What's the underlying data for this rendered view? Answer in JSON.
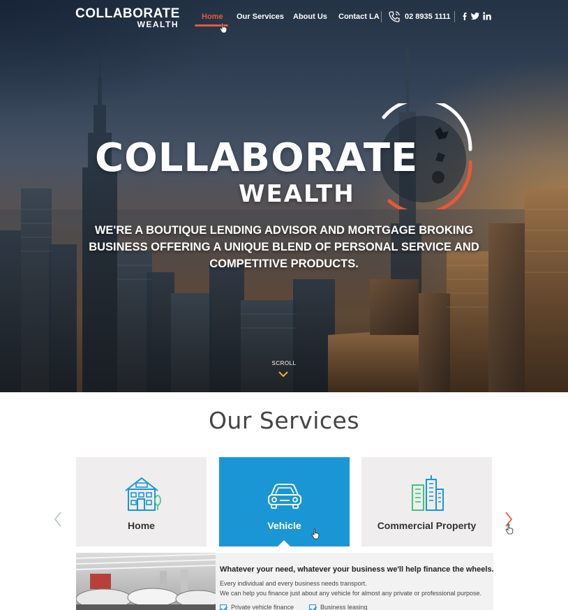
{
  "brand": {
    "logo_line1": "COLLABORATE",
    "logo_line2": "WEALTH",
    "accent_color": "#e8583a",
    "blue_color": "#1b96d4"
  },
  "nav": {
    "items": [
      {
        "label": "Home",
        "active": true
      },
      {
        "label": "Our Services",
        "active": false
      },
      {
        "label": "About Us",
        "active": false
      },
      {
        "label": "Contact LA",
        "active": false
      }
    ],
    "phone": "02 8935 1111",
    "phone_icon": "phone-icon",
    "social": [
      "facebook-icon",
      "twitter-icon",
      "linkedin-icon"
    ]
  },
  "hero": {
    "title_line1": "COLLABORATE",
    "title_line2": "WEALTH",
    "tagline": "WE'RE A BOUTIQUE LENDING ADVISOR AND MORTGAGE BROKING BUSINESS OFFERING A UNIQUE BLEND OF PERSONAL SERVICE AND COMPETITIVE PRODUCTS.",
    "scroll_label": "SCROLL"
  },
  "services": {
    "title": "Our Services",
    "cards": [
      {
        "label": "Home",
        "icon": "house-icon",
        "active": false
      },
      {
        "label": "Vehicle",
        "icon": "car-icon",
        "active": true
      },
      {
        "label": "Commercial Property",
        "icon": "office-buildings-icon",
        "active": false
      }
    ],
    "detail": {
      "heading": "Whatever your need, whatever your business we'll help finance the wheels.",
      "line1": "Every individual and every business needs transport.",
      "line2": "We can help you finance just about any vehicle for almost any private or professional purpose.",
      "checks": [
        "Private vehicle finance",
        "Business leasing"
      ]
    }
  }
}
